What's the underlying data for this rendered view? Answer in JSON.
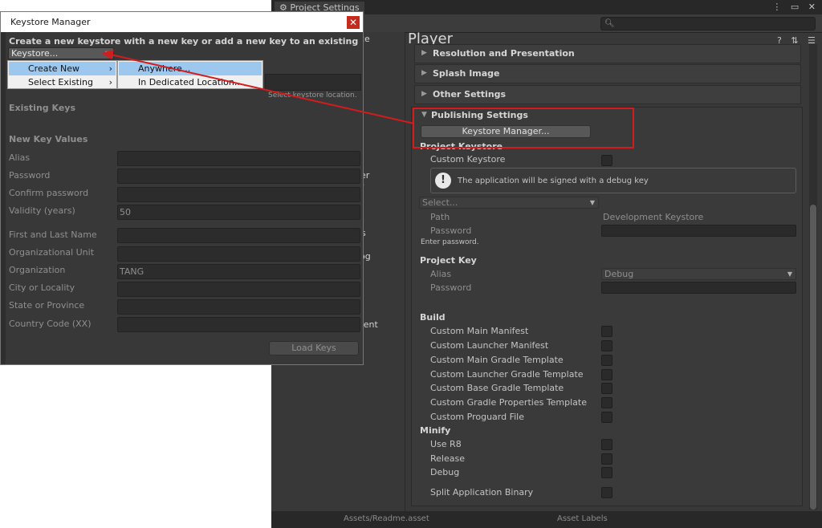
{
  "project_settings": {
    "tab_label": "Project Settings",
    "window_buttons": "⋮ ▭ ✕",
    "left_fragments": [
      "ce",
      "der",
      "er",
      "s",
      "og",
      "ment"
    ],
    "player_title": "Player",
    "header_icons": "? ⇅ ☰",
    "foldouts": [
      {
        "label": "Resolution and Presentation"
      },
      {
        "label": "Splash Image"
      },
      {
        "label": "Other Settings"
      },
      {
        "label": "Publishing Settings"
      }
    ],
    "keystore_manager_button": "Keystore Manager...",
    "project_keystore": {
      "heading": "Project Keystore",
      "custom_keystore_label": "Custom Keystore",
      "info_text": "The application will be signed with a debug key",
      "select_placeholder": "Select...",
      "path_label": "Path",
      "path_value": "Development Keystore",
      "password_label": "Password",
      "enter_password_hint": "Enter password."
    },
    "project_key": {
      "heading": "Project Key",
      "alias_label": "Alias",
      "alias_value": "Debug",
      "password_label": "Password"
    },
    "build": {
      "heading": "Build",
      "items": [
        "Custom Main Manifest",
        "Custom Launcher Manifest",
        "Custom Main Gradle Template",
        "Custom Launcher Gradle Template",
        "Custom Base Gradle Template",
        "Custom Gradle Properties Template",
        "Custom Proguard File"
      ]
    },
    "minify": {
      "heading": "Minify",
      "items": [
        "Use R8",
        "Release",
        "Debug"
      ]
    },
    "split_binary_label": "Split Application Binary",
    "bottom_bar_text": "Assets/Readme.asset",
    "bottom_bar_right": "Asset Labels"
  },
  "keystore_manager": {
    "title": "Keystore Manager",
    "close_glyph": "✕",
    "description": "Create a new keystore with a new key or add a new key to an existing keystore",
    "keystore_dropdown": "Keystore...",
    "ghost_hint": "Select keystore location.",
    "existing_keys_heading": "Existing Keys",
    "new_key_heading": "New Key Values",
    "fields": [
      {
        "label": "Alias",
        "value": ""
      },
      {
        "label": "Password",
        "value": ""
      },
      {
        "label": "Confirm password",
        "value": ""
      },
      {
        "label": "Validity (years)",
        "value": "50"
      },
      {
        "label": "First and Last Name",
        "value": ""
      },
      {
        "label": "Organizational Unit",
        "value": ""
      },
      {
        "label": "Organization",
        "value": "TANG"
      },
      {
        "label": "City or Locality",
        "value": ""
      },
      {
        "label": "State or Province",
        "value": ""
      },
      {
        "label": "Country Code (XX)",
        "value": ""
      }
    ],
    "load_keys_button": "Load Keys"
  },
  "context_menu": {
    "level1": [
      {
        "label": "Create New",
        "arrow": "›"
      },
      {
        "label": "Select Existing",
        "arrow": "›"
      }
    ],
    "level2": [
      {
        "label": "Anywhere..."
      },
      {
        "label": "In Dedicated Location..."
      }
    ]
  },
  "annotation_color": "#d41c1c"
}
